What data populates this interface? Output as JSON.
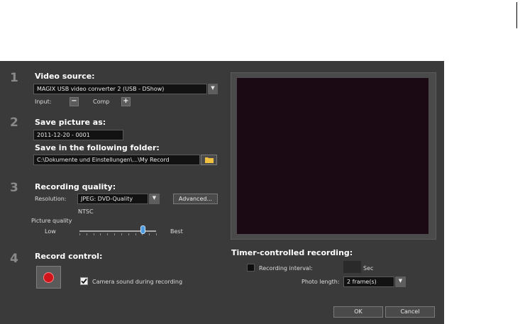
{
  "sections": {
    "video_source": {
      "number": "1",
      "heading": "Video source:",
      "device": "MAGIX USB video converter 2 (USB - DShow)",
      "input_label": "Input:",
      "input_value": "Comp"
    },
    "save_picture": {
      "number": "2",
      "heading": "Save picture as:",
      "filename": "2011-12-20 - 0001",
      "folder_heading": "Save in the following folder:",
      "folder_path": "C:\\Dokumente und Einstellungen\\...\\My Record"
    },
    "quality": {
      "number": "3",
      "heading": "Recording quality:",
      "resolution_label": "Resolution:",
      "resolution_value": "JPEG: DVD-Quality",
      "advanced_label": "Advanced...",
      "standard": "NTSC",
      "picture_quality_label": "Picture quality",
      "low_label": "Low",
      "best_label": "Best",
      "picture_quality_level": 0.82
    },
    "record": {
      "number": "4",
      "heading": "Record control:",
      "camera_sound_label": "Camera sound during recording",
      "camera_sound_checked": true
    }
  },
  "timer": {
    "heading": "Timer-controlled recording:",
    "interval_label": "Recording interval:",
    "interval_checked": false,
    "interval_value": "",
    "sec_label": "Sec",
    "photo_length_label": "Photo length:",
    "photo_length_value": "2 frame(s)"
  },
  "buttons": {
    "ok": "OK",
    "cancel": "Cancel"
  },
  "colors": {
    "dialog_bg": "#3a3a3a",
    "record_red": "#d0141c",
    "slider_thumb": "#4b9be0"
  }
}
